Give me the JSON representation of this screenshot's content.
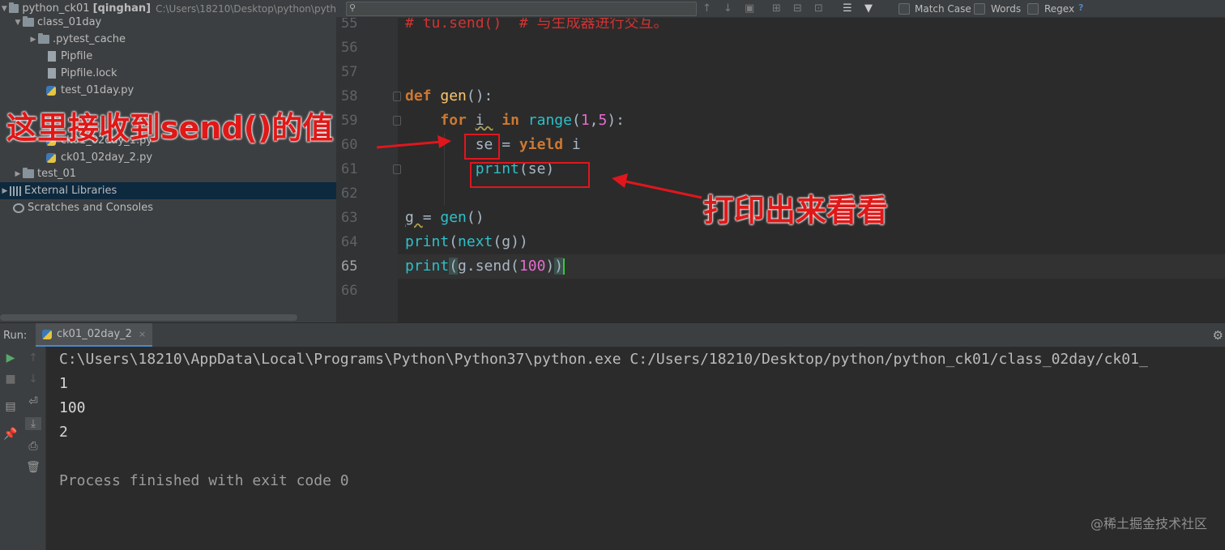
{
  "project_tree": {
    "root_name": "python_ck01",
    "root_user": "[qinghan]",
    "root_path": "C:\\Users\\18210\\Desktop\\python\\pyth",
    "items": [
      {
        "label": "class_01day"
      },
      {
        "label": ".pytest_cache"
      },
      {
        "label": "Pipfile"
      },
      {
        "label": "Pipfile.lock"
      },
      {
        "label": "test_01day.py"
      },
      {
        "label": "ck01_02day_1.py"
      },
      {
        "label": "ck01_02day_2.py"
      },
      {
        "label": "test_01"
      },
      {
        "label": "External Libraries"
      },
      {
        "label": "Scratches and Consoles"
      }
    ]
  },
  "find_bar": {
    "search_value": "",
    "match_case": "Match Case",
    "words": "Words",
    "regex": "Regex",
    "help": "?"
  },
  "editor": {
    "line_numbers": [
      "55",
      "56",
      "57",
      "58",
      "59",
      "60",
      "61",
      "62",
      "63",
      "64",
      "65",
      "66"
    ],
    "current_line": "65",
    "comment_line": "# tu.send()  # 与生成器进行交互。"
  },
  "annotations": {
    "left_note": "这里接收到send()的值",
    "right_note": "打印出来看看"
  },
  "run_panel": {
    "label": "Run:",
    "tab_name": "ck01_02day_2",
    "tab_close": "×",
    "console": [
      "C:\\Users\\18210\\AppData\\Local\\Programs\\Python\\Python37\\python.exe C:/Users/18210/Desktop/python/python_ck01/class_02day/ck01_",
      "1",
      "100",
      "2",
      "",
      "Process finished with exit code 0"
    ]
  },
  "watermark": "@稀土掘金技术社区",
  "colors": {
    "background": "#2b2b2b",
    "keyword": "#cc7832",
    "function": "#ffc66d",
    "annotation": "#e0161d"
  }
}
